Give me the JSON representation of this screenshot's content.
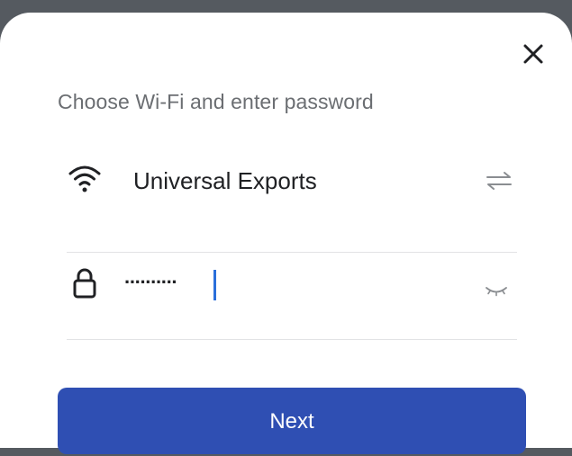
{
  "dialog": {
    "title": "Choose Wi-Fi and enter password",
    "close_icon": "close-icon"
  },
  "wifi": {
    "icon": "wifi-icon",
    "network_name": "Universal Exports",
    "switch_icon": "switch-network-icon"
  },
  "password": {
    "icon": "lock-icon",
    "masked_value": "··········",
    "reveal_icon": "eye-closed-icon"
  },
  "actions": {
    "next_label": "Next"
  },
  "colors": {
    "primary": "#2f4fb3",
    "caret": "#2a6fdb",
    "title_text": "#6b6e72",
    "divider": "#e2e3e5"
  }
}
